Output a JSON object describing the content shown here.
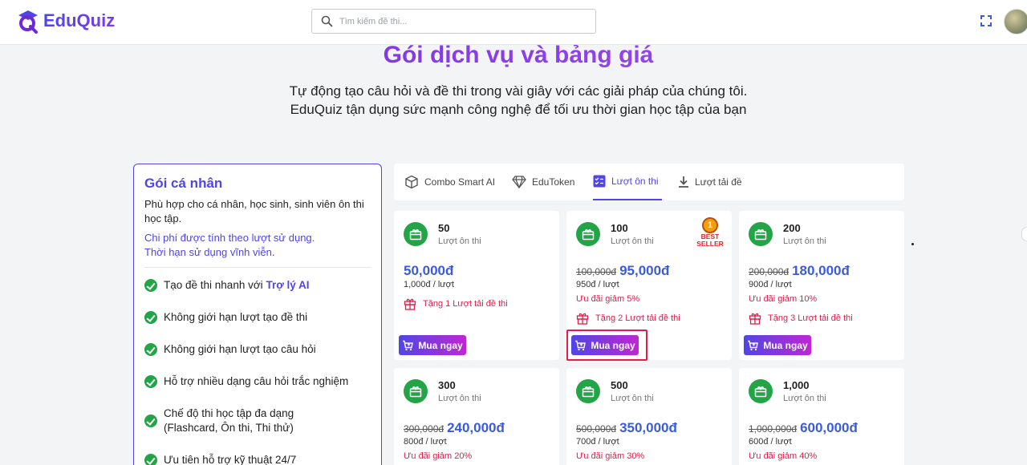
{
  "app": {
    "logo_text": "EduQuiz"
  },
  "search": {
    "placeholder": "Tìm kiếm đề thi..."
  },
  "hero": {
    "title": "Gói dịch vụ và bảng giá",
    "subtitle_line1": "Tự động tạo câu hỏi và đề thi trong vài giây với các giải pháp của chúng tôi.",
    "subtitle_line2": "EduQuiz tận dụng sức mạnh công nghệ để tối ưu thời gian học tập của bạn"
  },
  "plan": {
    "title": "Gói cá nhân",
    "description": "Phù hợp cho cá nhân, học sinh, sinh viên ôn thi học tập.",
    "note_line1": "Chi phí được tính theo lượt sử dụng.",
    "note_line2": "Thời hạn sử dụng vĩnh viễn.",
    "features": [
      {
        "text": "Tạo đề thi nhanh với ",
        "highlight": "Trợ lý AI"
      },
      {
        "text": "Không giới hạn lượt tạo đề thi",
        "highlight": ""
      },
      {
        "text": "Không giới hạn lượt tạo câu hỏi",
        "highlight": ""
      },
      {
        "text": "Hỗ trợ nhiều dạng câu hỏi trắc nghiệm",
        "highlight": ""
      },
      {
        "text": "Chế độ thi học tập đa dạng (Flashcard, Ôn thi, Thi thử)",
        "highlight": ""
      },
      {
        "text": "Ưu tiên hỗ trợ kỹ thuật 24/7",
        "highlight": ""
      }
    ]
  },
  "tabs": [
    {
      "label": "Combo Smart AI",
      "icon": "box-icon",
      "active": false
    },
    {
      "label": "EduToken",
      "icon": "diamond-icon",
      "active": false
    },
    {
      "label": "Lượt ôn thi",
      "icon": "checklist-icon",
      "active": true
    },
    {
      "label": "Lượt tải đề",
      "icon": "download-icon",
      "active": false
    }
  ],
  "buy_label": "Mua ngay",
  "unit_label": "Lượt ôn thi",
  "badge": {
    "coin": "1",
    "line1": "BEST",
    "line2": "SELLER"
  },
  "accent_colors": {
    "primary": "#4f46e5",
    "price": "#3b5bdb",
    "discount": "#e11d48",
    "icon_bg": "#22a447"
  },
  "packages": [
    {
      "qty": "50",
      "old_price": "",
      "price": "50,000đ",
      "per": "1,000đ / lượt",
      "discount": "",
      "gift": "Tặng 1 Lượt tải đề thi",
      "best_seller": false
    },
    {
      "qty": "100",
      "old_price": "100,000đ",
      "price": "95,000đ",
      "per": "950đ / lượt",
      "discount": "Ưu đãi giảm 5%",
      "gift": "Tặng 2 Lượt tải đề thi",
      "best_seller": true
    },
    {
      "qty": "200",
      "old_price": "200,000đ",
      "price": "180,000đ",
      "per": "900đ / lượt",
      "discount": "Ưu đãi giảm 10%",
      "gift": "Tặng 3 Lượt tải đề thi",
      "best_seller": false
    },
    {
      "qty": "300",
      "old_price": "300,000đ",
      "price": "240,000đ",
      "per": "800đ / lượt",
      "discount": "Ưu đãi giảm 20%",
      "gift": "",
      "best_seller": false
    },
    {
      "qty": "500",
      "old_price": "500,000đ",
      "price": "350,000đ",
      "per": "700đ / lượt",
      "discount": "Ưu đãi giảm 30%",
      "gift": "",
      "best_seller": false
    },
    {
      "qty": "1,000",
      "old_price": "1,000,000đ",
      "price": "600,000đ",
      "per": "600đ / lượt",
      "discount": "Ưu đãi giảm 40%",
      "gift": "",
      "best_seller": false
    }
  ]
}
